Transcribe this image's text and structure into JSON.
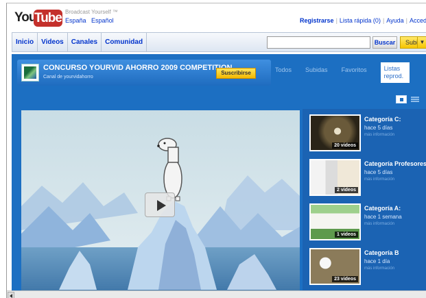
{
  "header": {
    "logo_you": "You",
    "logo_tube": "Tube",
    "tagline": "Broadcast Yourself ™",
    "locale": [
      "España",
      "Español"
    ],
    "links": [
      {
        "label": "Registrarse",
        "bold": true
      },
      {
        "label": "Lista rápida (0)",
        "bold": false
      },
      {
        "label": "Ayuda",
        "bold": false
      },
      {
        "label": "Acced",
        "bold": false
      }
    ]
  },
  "nav": {
    "items": [
      "Inicio",
      "Videos",
      "Canales",
      "Comunidad"
    ],
    "search_value": "",
    "search_button": "Buscar",
    "upload_button": "Subi"
  },
  "channel": {
    "title": "CONCURSO YOURVID AHORRO 2009 COMPETITION",
    "subtitle": "Canal de yourvidahorro",
    "subscribe": "Suscribirse",
    "tabs": [
      "Todos",
      "Subidas",
      "Favoritos",
      "Listas reprod."
    ],
    "active_tab": "Listas reprod."
  },
  "playlists": [
    {
      "title": "Categoría C:",
      "time": "hace 5 días",
      "more": "más información",
      "count": "20 videos"
    },
    {
      "title": "Categoría Profesores",
      "time": "hace 5 días",
      "more": "más información",
      "count": "2 videos"
    },
    {
      "title": "Categoría A:",
      "time": "hace 1 semana",
      "more": "más información",
      "count": "1 videos"
    },
    {
      "title": "Categoría B",
      "time": "hace 1 día",
      "more": "más información",
      "count": "23 videos"
    }
  ],
  "colors": {
    "channel_bg": "#1c6fc2",
    "logo_red": "#c4302b",
    "link_blue": "#0033cc",
    "subscribe_yellow": "#f3b800"
  }
}
